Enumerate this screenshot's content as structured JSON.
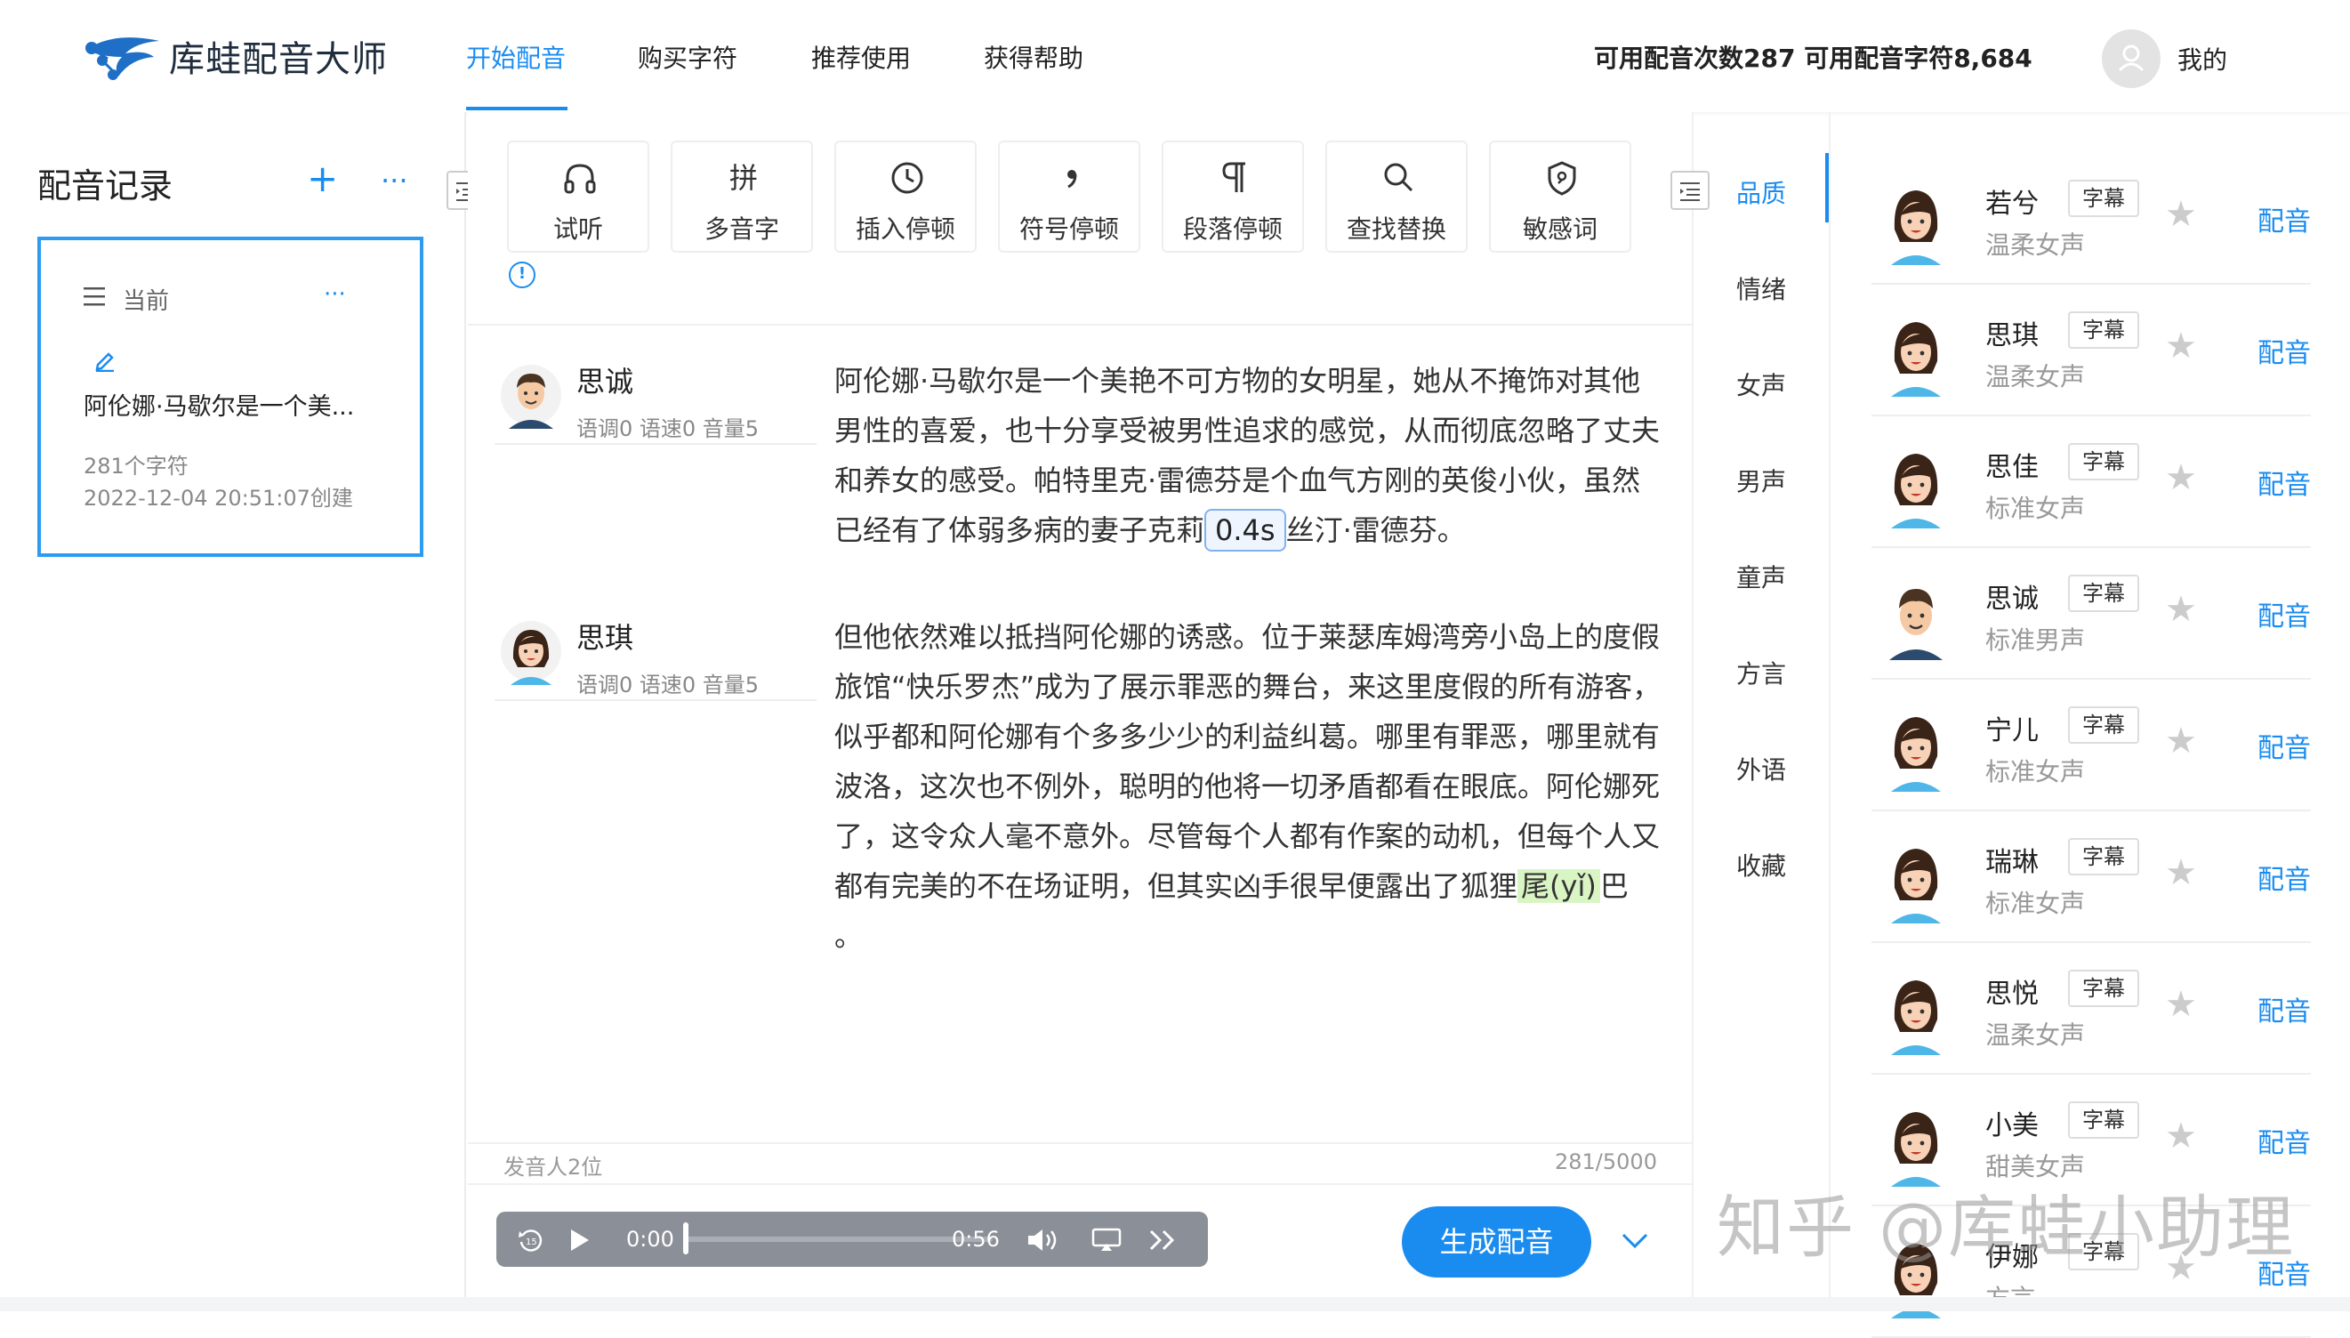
{
  "header": {
    "app_name": "库蛙配音大师",
    "nav": [
      "开始配音",
      "购买字符",
      "推荐使用",
      "获得帮助"
    ],
    "quota": "可用配音次数287 可用配音字符8,684",
    "mine": "我的"
  },
  "left": {
    "title": "配音记录",
    "plus": "+",
    "more": "···",
    "card": {
      "current": "当前",
      "more": "···",
      "title": "阿伦娜·马歇尔是一个美...",
      "chars": "281个字符",
      "created": "2022-12-04 20:51:07创建"
    }
  },
  "toolbar": {
    "tools": [
      "试听",
      "多音字",
      "插入停顿",
      "符号停顿",
      "段落停顿",
      "查找替换",
      "敏感词"
    ],
    "icons": [
      "headphones-icon",
      "pinyin-icon",
      "clock-icon",
      "comma-icon",
      "pilcrow-icon",
      "search-icon",
      "shield-icon"
    ],
    "info": "!"
  },
  "editor": {
    "blocks": [
      {
        "speaker": "思诚",
        "meta": "语调0 语速0 音量5",
        "text_before": "阿伦娜·马歇尔是一个美艳不可方物的女明星，她从不掩饰对其他男性的喜爱，也十分享受被男性追求的感觉，从而彻底忽略了丈夫和养女的感受。帕特里克·雷德芬是个血气方刚的英俊小伙，虽然已经有了体弱多病的妻子克莉",
        "pause_tag": "0.4s",
        "text_after": "丝汀·雷德芬。"
      },
      {
        "speaker": "思琪",
        "meta": "语调0 语速0 音量5",
        "text_before": "但他依然难以抵挡阿伦娜的诱惑。位于莱瑟库姆湾旁小岛上的度假旅馆“快乐罗杰”成为了展示罪恶的舞台，来这里度假的所有游客，似乎都和阿伦娜有个多多少少的利益纠葛。哪里有罪恶，哪里就有波洛，这次也不例外，聪明的他将一切矛盾都看在眼底。阿伦娜死了，这令众人毫不意外。尽管每个人都有作案的动机，但每个人又都有完美的不在场证明，但其实凶手很早便露出了狐狸",
        "highlight": "尾(yǐ)",
        "text_after": "巴 。"
      }
    ],
    "speakers_count": "发音人2位",
    "char_count": "281/5000"
  },
  "player": {
    "current_time": "0:00",
    "duration": "0:56",
    "progress": 0
  },
  "generate_button": "生成配音",
  "categories": [
    "品质",
    "情绪",
    "女声",
    "男声",
    "童声",
    "方言",
    "外语",
    "收藏"
  ],
  "voices": [
    {
      "name": "若兮",
      "badge": "字幕",
      "desc": "温柔女声",
      "action": "配音",
      "gender": "female"
    },
    {
      "name": "思琪",
      "badge": "字幕",
      "desc": "温柔女声",
      "action": "配音",
      "gender": "female"
    },
    {
      "name": "思佳",
      "badge": "字幕",
      "desc": "标准女声",
      "action": "配音",
      "gender": "female"
    },
    {
      "name": "思诚",
      "badge": "字幕",
      "desc": "标准男声",
      "action": "配音",
      "gender": "male"
    },
    {
      "name": "宁儿",
      "badge": "字幕",
      "desc": "标准女声",
      "action": "配音",
      "gender": "female"
    },
    {
      "name": "瑞琳",
      "badge": "字幕",
      "desc": "标准女声",
      "action": "配音",
      "gender": "female"
    },
    {
      "name": "思悦",
      "badge": "字幕",
      "desc": "温柔女声",
      "action": "配音",
      "gender": "female"
    },
    {
      "name": "小美",
      "badge": "字幕",
      "desc": "甜美女声",
      "action": "配音",
      "gender": "female"
    },
    {
      "name": "伊娜",
      "badge": "字幕",
      "desc": "方言",
      "action": "配音",
      "gender": "female"
    }
  ],
  "watermark": "知乎 @库蛙小助理",
  "colors": {
    "accent": "#1a8cf0",
    "player": "#8b8f97"
  }
}
